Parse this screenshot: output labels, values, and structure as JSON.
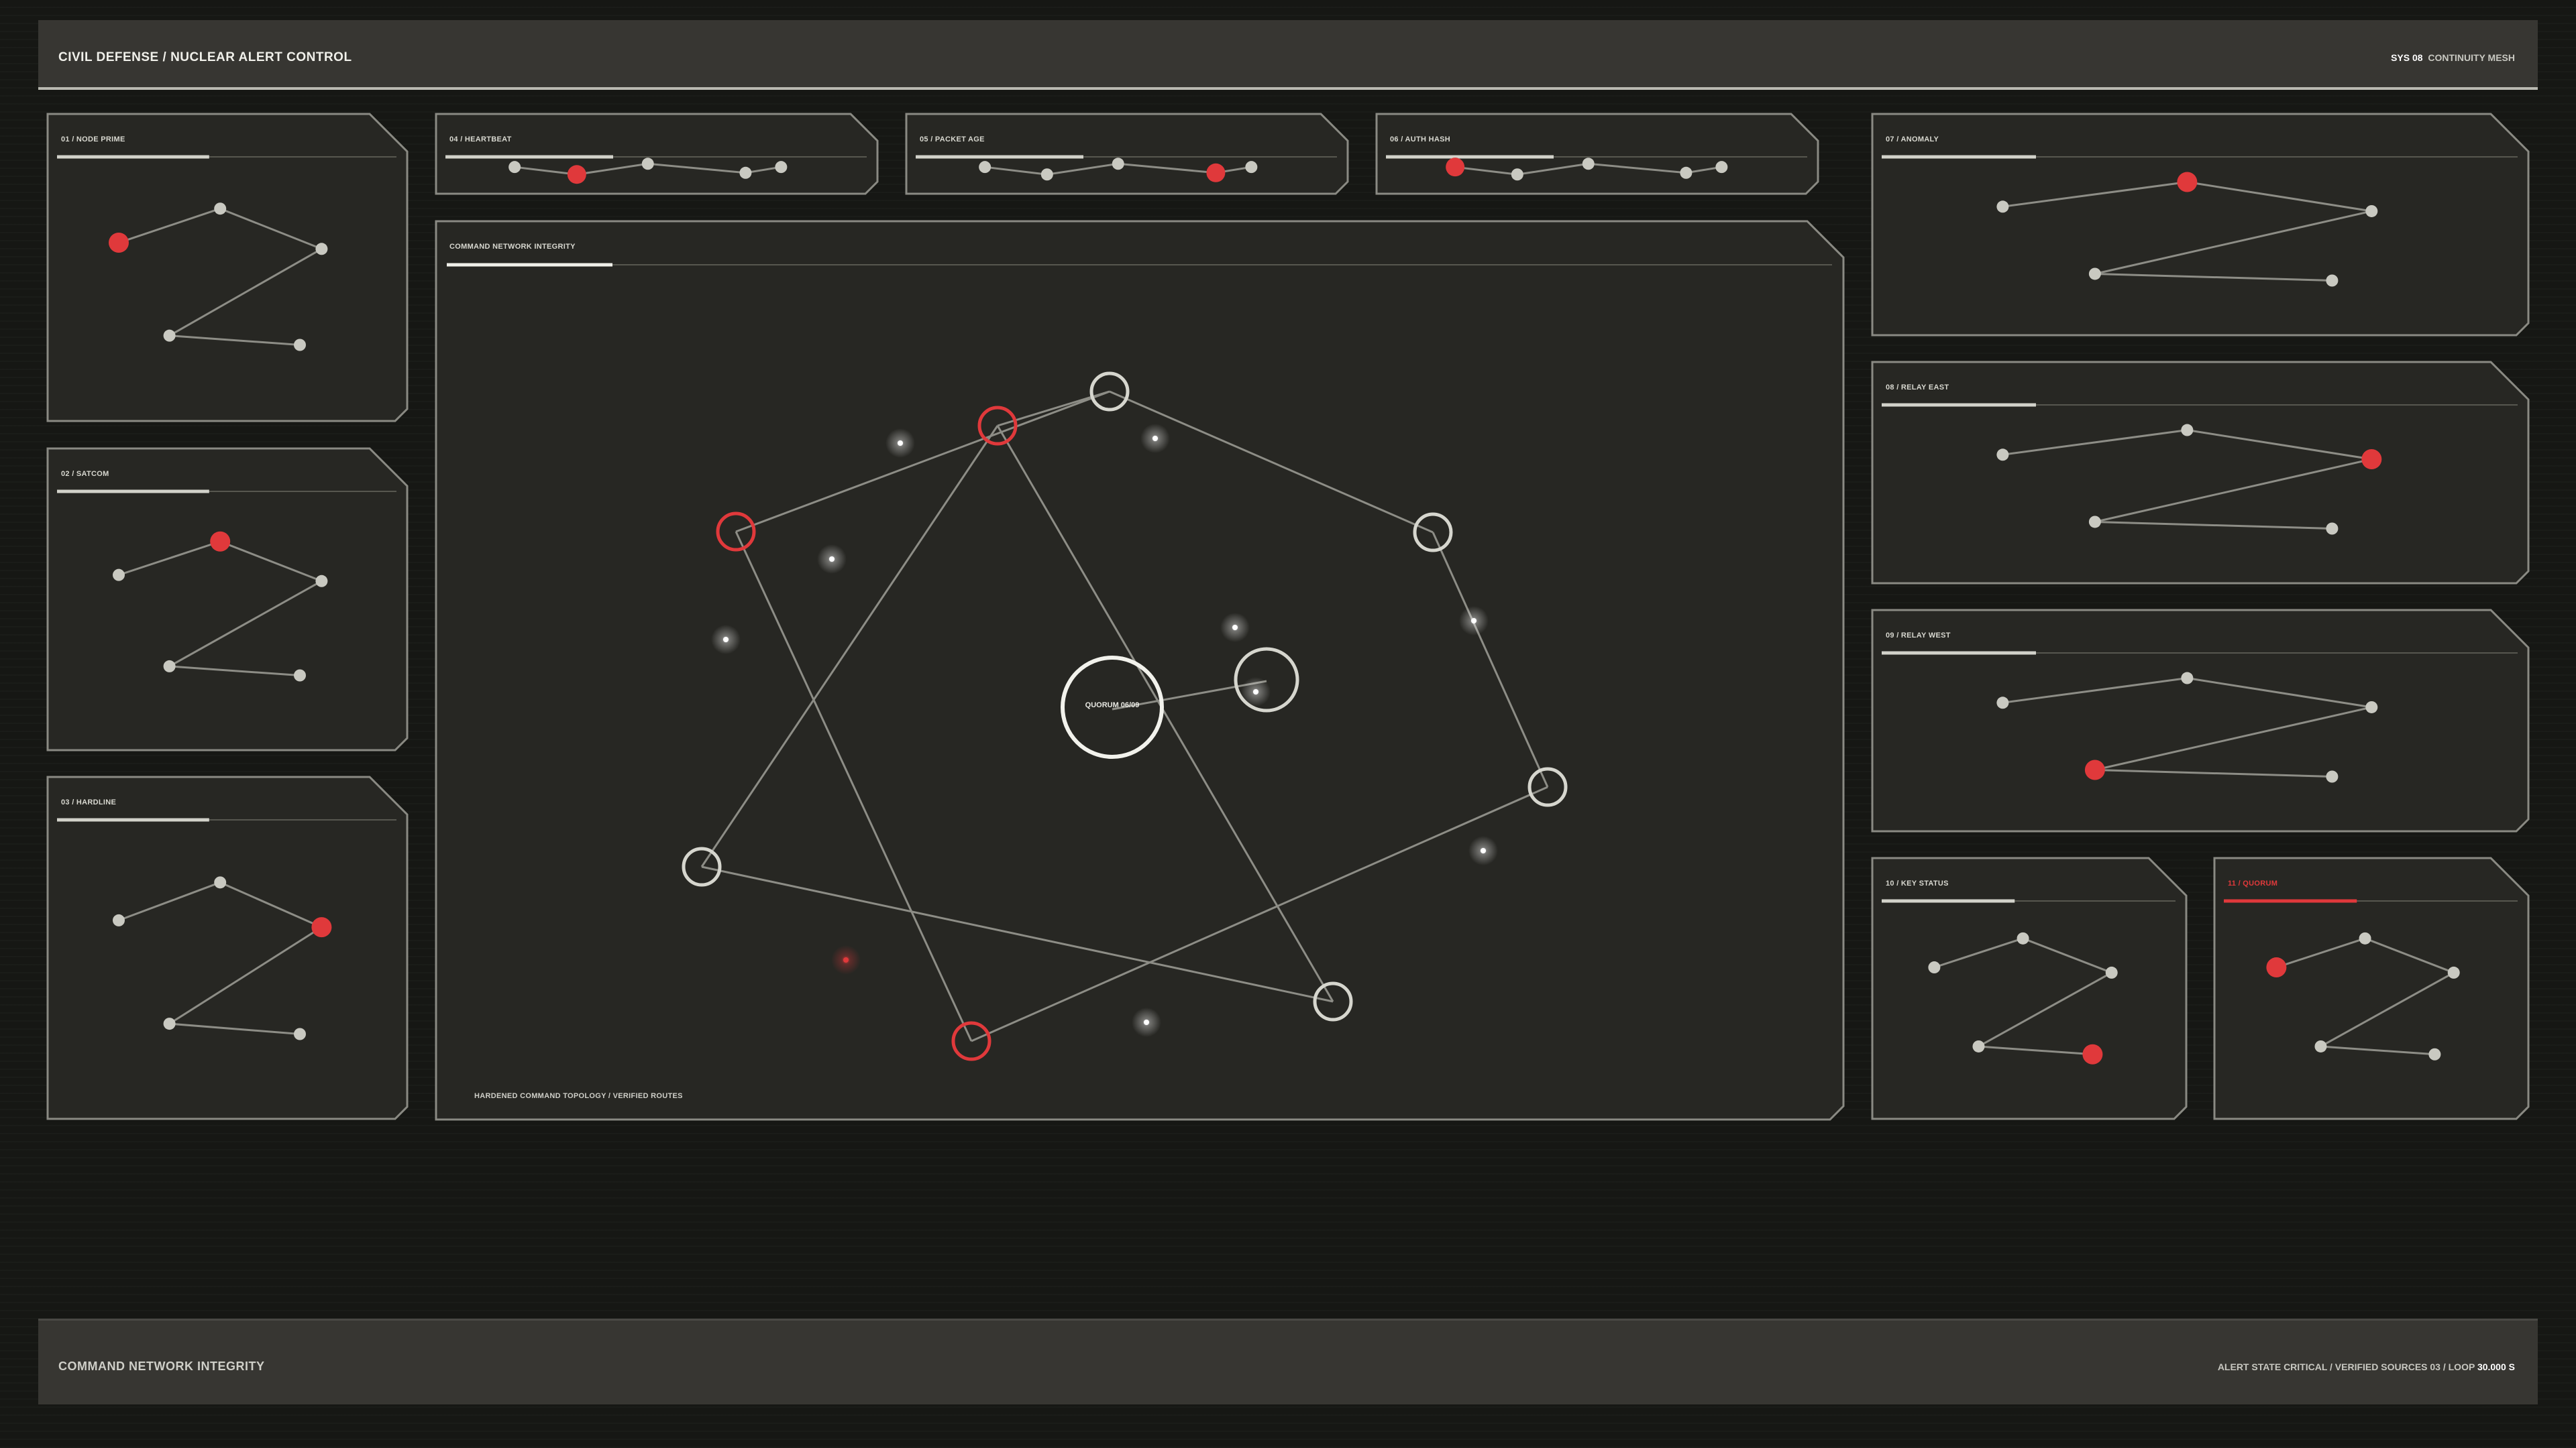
{
  "header": {
    "title": "CIVIL DEFENSE / NUCLEAR ALERT CONTROL",
    "sys_prefix": "SYS 08",
    "sys_name": "CONTINUITY MESH"
  },
  "footer": {
    "title": "COMMAND NETWORK INTEGRITY",
    "status_prefix": "ALERT STATE  CRITICAL / VERIFIED SOURCES 03 / LOOP",
    "loop_value": "30.000 S"
  },
  "colors": {
    "alert": "#e0393b",
    "node": "#c9c9c1",
    "line": "#8d8d86",
    "panel_bg": "#272723",
    "panel_border": "#8a8a83"
  },
  "node_panels": [
    {
      "id": "01",
      "label": "01 / NODE PRIME",
      "alert_node": 0,
      "status": "normal"
    },
    {
      "id": "02",
      "label": "02 / SATCOM",
      "alert_node": 1,
      "status": "normal"
    },
    {
      "id": "03",
      "label": "03 / HARDLINE",
      "alert_node": 2,
      "status": "normal"
    },
    {
      "id": "04",
      "label": "04 / HEARTBEAT",
      "alert_node": 1,
      "status": "normal"
    },
    {
      "id": "05",
      "label": "05 / PACKET AGE",
      "alert_node": 3,
      "status": "normal"
    },
    {
      "id": "06",
      "label": "06 / AUTH HASH",
      "alert_node": 0,
      "status": "normal"
    },
    {
      "id": "07",
      "label": "07 / ANOMALY",
      "alert_node": 1,
      "status": "normal"
    },
    {
      "id": "08",
      "label": "08 / RELAY EAST",
      "alert_node": 2,
      "status": "normal"
    },
    {
      "id": "09",
      "label": "09 / RELAY WEST",
      "alert_node": 3,
      "status": "normal"
    },
    {
      "id": "10",
      "label": "10 / KEY STATUS",
      "alert_node": 4,
      "status": "normal"
    },
    {
      "id": "11",
      "label": "11 / QUORUM",
      "alert_node": 0,
      "status": "alert"
    }
  ],
  "main": {
    "title": "COMMAND NETWORK INTEGRITY",
    "caption": "HARDENED COMMAND TOPOLOGY / VERIFIED ROUTES",
    "quorum_label": "QUORUM 06/09",
    "quorum_count": 6,
    "quorum_total": 9,
    "nodes": [
      {
        "id": "n1",
        "status": "alert"
      },
      {
        "id": "n2",
        "status": "normal"
      },
      {
        "id": "n3",
        "status": "normal"
      },
      {
        "id": "n4",
        "status": "normal"
      },
      {
        "id": "n5",
        "status": "alert"
      },
      {
        "id": "n6",
        "status": "alert"
      },
      {
        "id": "n7",
        "status": "normal"
      },
      {
        "id": "n8",
        "status": "normal"
      }
    ]
  }
}
